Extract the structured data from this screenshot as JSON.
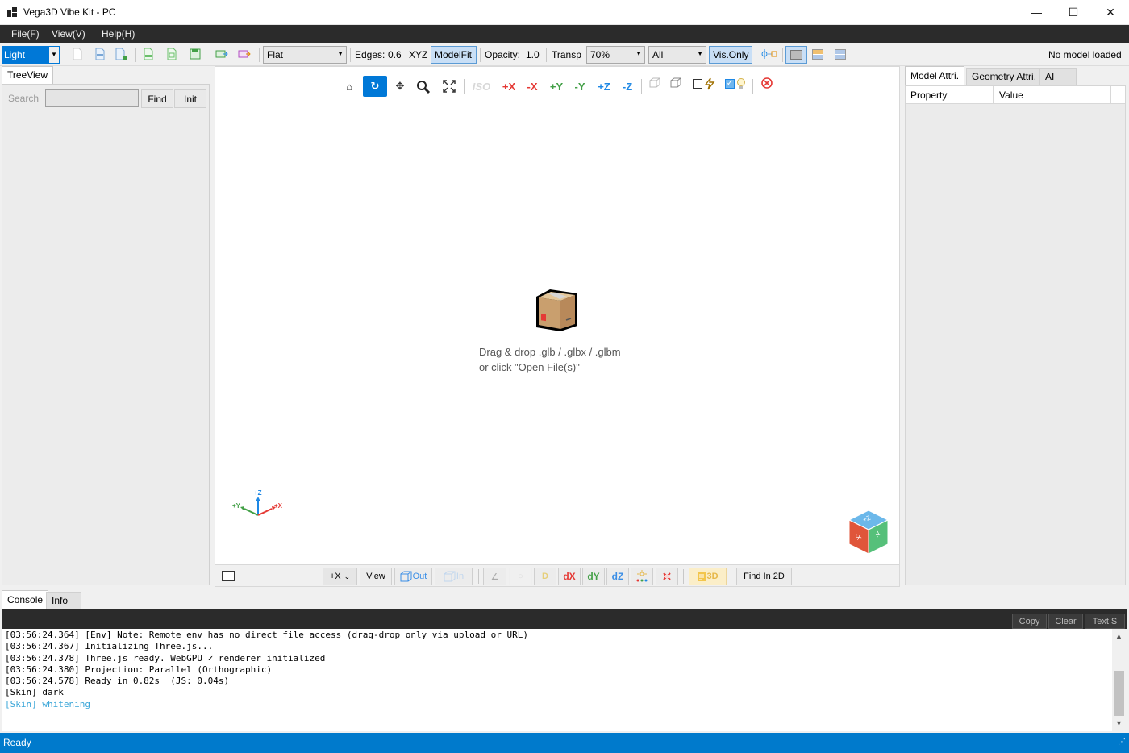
{
  "window": {
    "title": "Vega3D Vibe Kit - PC",
    "minimize": "—",
    "maximize": "☐",
    "close": "✕"
  },
  "menu": {
    "file": "File(F)",
    "view": "View(V)",
    "help": "Help(H)"
  },
  "toolbar": {
    "theme": "Light",
    "shading": "Flat",
    "edges_label": "Edges:",
    "edges_value": "0.6",
    "xyz": "XYZ",
    "modelfit": "ModelFit",
    "opacity_label": "Opacity:",
    "opacity_value": "1.0",
    "transp_label": "Transp",
    "transp_value": "70%",
    "filter_value": "All",
    "visonly": "Vis.Only",
    "status": "No model loaded"
  },
  "tree": {
    "tab": "TreeView",
    "search_label": "Search",
    "find": "Find",
    "init": "Init"
  },
  "viewport": {
    "home": "⌂",
    "rotate": "↻",
    "pan": "✥",
    "zoom": "🔍",
    "fit": "⛶",
    "iso": "ISO",
    "px": "+X",
    "nx": "-X",
    "py": "+Y",
    "ny": "-Y",
    "pz": "+Z",
    "nz": "-Z",
    "drop_line1": "Drag & drop .glb / .glbx / .glbm",
    "drop_line2": "or click \"Open File(s)\"",
    "axis_z": "+Z",
    "axis_y": "+Y",
    "axis_x": "+X",
    "cube_top": "+Z",
    "cube_left": "-X",
    "cube_right": "-Y"
  },
  "bottom": {
    "axis_select": "+X",
    "view": "View",
    "out": "Out",
    "in": "In",
    "d": "D",
    "dx": "dX",
    "dy": "dY",
    "dz": "dZ",
    "tag3d": "3D",
    "find2d": "Find In 2D"
  },
  "props": {
    "tab_model": "Model Attri.",
    "tab_geometry": "Geometry Attri.",
    "tab_ai": "AI",
    "col_property": "Property",
    "col_value": "Value"
  },
  "console": {
    "tab_console": "Console",
    "tab_info": "Info",
    "copy": "Copy",
    "clear": "Clear",
    "text": "Text S",
    "lines": [
      "[03:56:24.364] [Env] Note: Remote env has no direct file access (drag-drop only via upload or URL)",
      "[03:56:24.367] Initializing Three.js...",
      "[03:56:24.378] Three.js ready. WebGPU ✓ renderer initialized",
      "[03:56:24.380] Projection: Parallel (Orthographic)",
      "[03:56:24.578] Ready in 0.82s  (JS: 0.04s)",
      "[Skin] dark",
      "[Skin] whitening"
    ]
  },
  "statusbar": {
    "text": "Ready"
  },
  "colors": {
    "accent": "#007acc",
    "selected": "#0078d7",
    "axis_x": "#e53935",
    "axis_y": "#43a047",
    "axis_z": "#1e88e5"
  }
}
